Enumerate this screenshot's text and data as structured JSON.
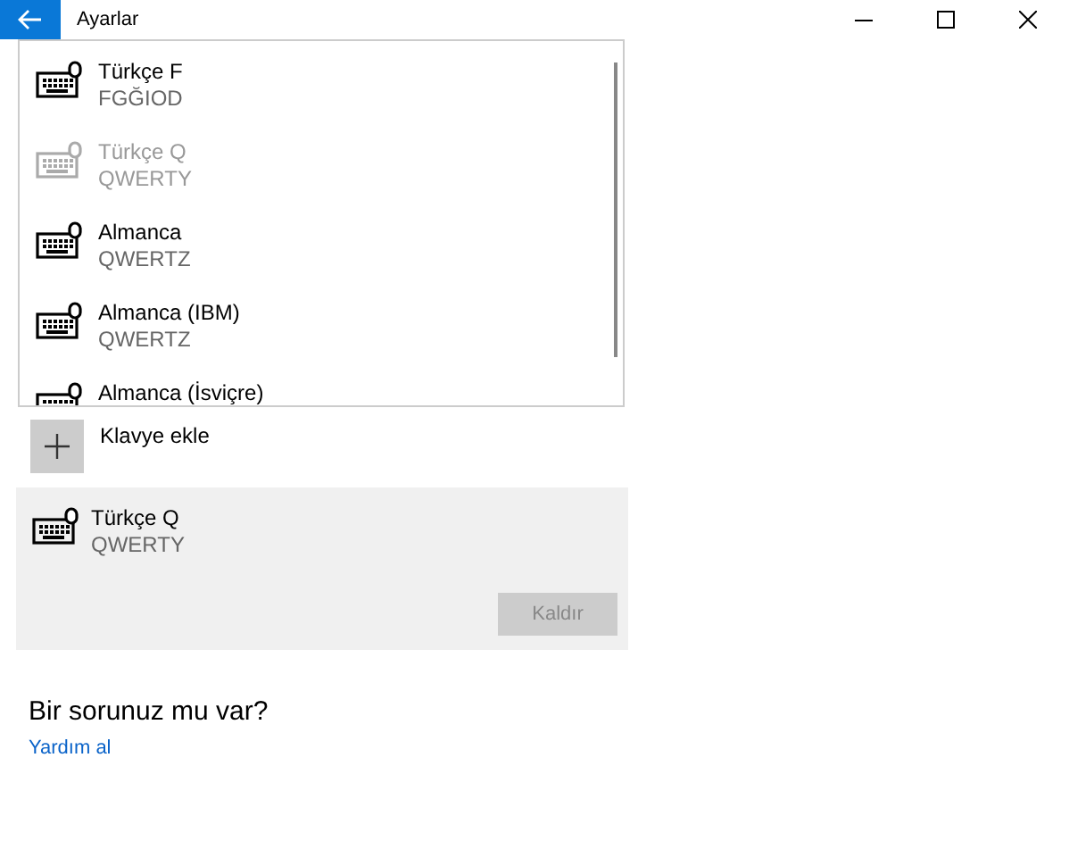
{
  "window": {
    "title": "Ayarlar"
  },
  "dropdown": {
    "items": [
      {
        "name": "Türkçe F",
        "layout": "FGĞIOD",
        "disabled": false
      },
      {
        "name": "Türkçe Q",
        "layout": "QWERTY",
        "disabled": true
      },
      {
        "name": "Almanca",
        "layout": "QWERTZ",
        "disabled": false
      },
      {
        "name": "Almanca (IBM)",
        "layout": "QWERTZ",
        "disabled": false
      },
      {
        "name": "Almanca (İsviçre)",
        "disabled": false
      }
    ]
  },
  "add_keyboard": {
    "label": "Klavye ekle"
  },
  "selected_keyboard": {
    "name": "Türkçe Q",
    "layout": "QWERTY",
    "remove_button": {
      "label": "Kaldır",
      "disabled": true
    }
  },
  "help": {
    "heading": "Bir sorunuz mu var?",
    "link": "Yardım al"
  }
}
